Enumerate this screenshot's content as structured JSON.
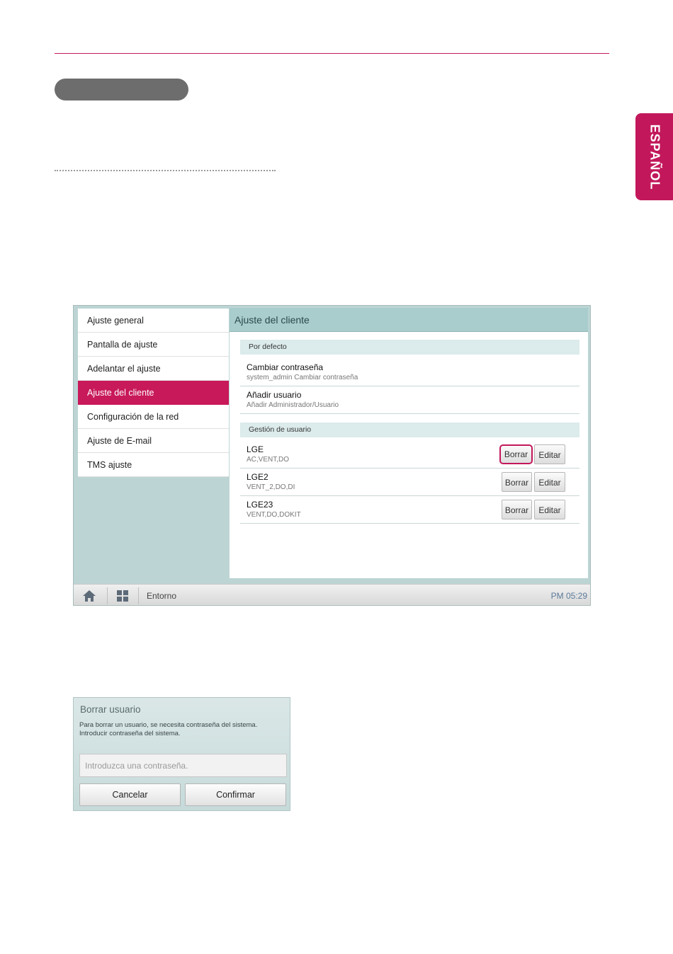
{
  "language_tab": "ESPAÑOL",
  "accent_color": "#c8195a",
  "sidebar": {
    "items": [
      {
        "label": "Ajuste general",
        "active": false
      },
      {
        "label": "Pantalla de ajuste",
        "active": false
      },
      {
        "label": "Adelantar el ajuste",
        "active": false
      },
      {
        "label": "Ajuste del cliente",
        "active": true
      },
      {
        "label": "Configuración de la red",
        "active": false
      },
      {
        "label": "Ajuste de E-mail",
        "active": false
      },
      {
        "label": "TMS ajuste",
        "active": false
      }
    ]
  },
  "content": {
    "title": "Ajuste del cliente",
    "default_section": "Por defecto",
    "change_password": {
      "title": "Cambiar contraseña",
      "subtitle": "system_admin Cambiar contraseña"
    },
    "add_user": {
      "title": "Añadir usuario",
      "subtitle": "Añadir Administrador/Usuario"
    },
    "user_section": "Gestión de usuario",
    "users": [
      {
        "name": "LGE",
        "perms": "AC,VENT,DO"
      },
      {
        "name": "LGE2",
        "perms": "VENT_2,DO,DI"
      },
      {
        "name": "LGE23",
        "perms": "VENT,DO,DOKIT"
      }
    ],
    "delete_label": "Borrar",
    "edit_label": "Editar"
  },
  "statusbar": {
    "home_icon": "home-icon",
    "apps_icon": "grid-icon",
    "label": "Entorno",
    "time": "PM 05:29"
  },
  "dialog": {
    "title": "Borrar usuario",
    "message": "Para borrar un usuario, se necesita contraseña del sistema.\n Introducir contraseña del sistema.",
    "placeholder": "Introduzca una contraseña.",
    "cancel_label": "Cancelar",
    "confirm_label": "Confirmar"
  }
}
